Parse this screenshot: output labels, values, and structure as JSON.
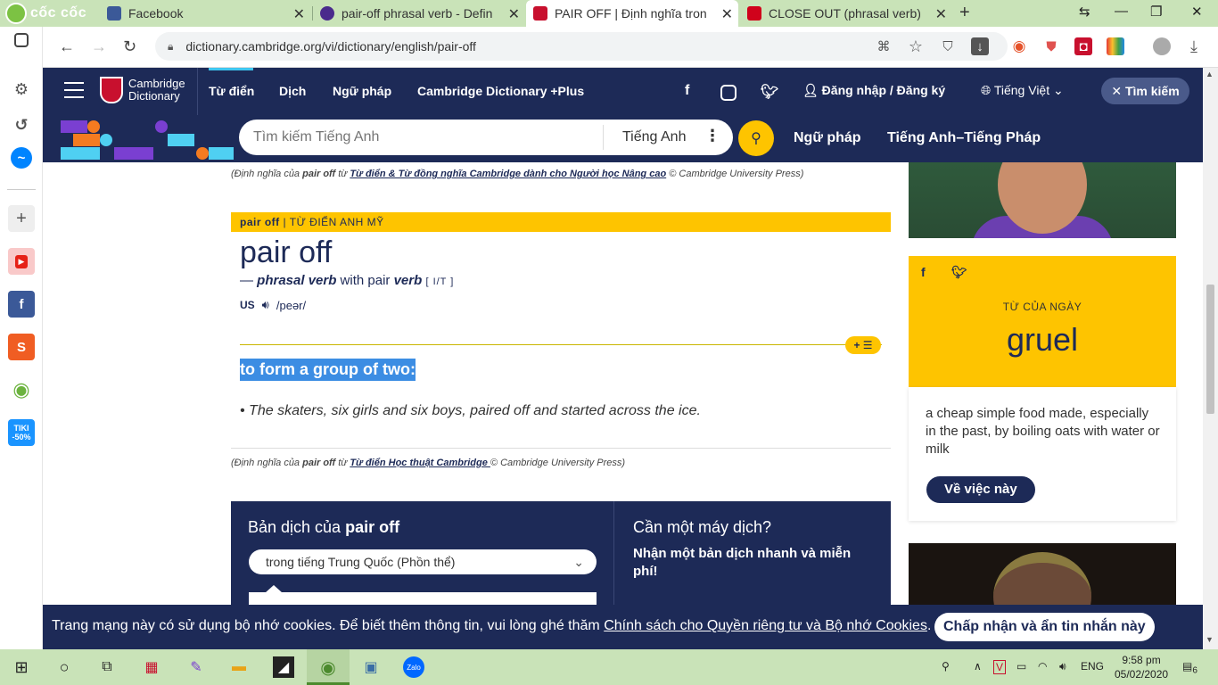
{
  "browser": {
    "brand": "cốc cốc",
    "tabs": [
      {
        "title": "Facebook",
        "favicon_color": "#3b5998"
      },
      {
        "title": "pair-off phrasal verb - Definiti",
        "favicon_color": "#4a2b8c"
      },
      {
        "title": "PAIR OFF | Định nghĩa trong T",
        "favicon_color": "#c8102e"
      },
      {
        "title": "CLOSE OUT (phrasal verb) def",
        "favicon_color": "#d0021b"
      }
    ],
    "url": "dictionary.cambridge.org/vi/dictionary/english/pair-off"
  },
  "header": {
    "logo_line1": "Cambridge",
    "logo_line2": "Dictionary",
    "nav": [
      "Từ điển",
      "Dịch",
      "Ngữ pháp",
      "Cambridge Dictionary +Plus"
    ],
    "login": "Đăng nhập / Đăng ký",
    "language": "Tiếng Việt",
    "search_toggle": "Tìm kiếm"
  },
  "search": {
    "placeholder": "Tìm kiếm Tiếng Anh",
    "language": "Tiếng Anh",
    "links": [
      "Ngữ pháp",
      "Tiếng Anh–Tiếng Pháp"
    ]
  },
  "entry": {
    "credit_top": {
      "prefix": "(Định nghĩa của ",
      "word": "pair off",
      "mid": " từ ",
      "source": "Từ điển & Từ đồng nghĩa Cambridge dành cho Người học Nâng cao",
      "suffix": " © Cambridge University Press)"
    },
    "bar_word": "pair off",
    "bar_dict": "TỪ ĐIỂN ANH MỸ",
    "headword": "pair off",
    "pos_dash": "— ",
    "pos": "phrasal verb",
    "pos_with": " with pair ",
    "pos_verb": "verb",
    "grammar": "[ I/T ]",
    "region": "US",
    "ipa": "/peər/",
    "definition": "to form a group of two:",
    "example": "The skaters, six girls and six boys, paired off and started across the ice.",
    "credit_bottom": {
      "prefix": "(Định nghĩa của ",
      "word": "pair off",
      "mid": " từ ",
      "source": "Từ điển Học thuật Cambridge ",
      "suffix": "© Cambridge University Press)"
    }
  },
  "translation": {
    "title_prefix": "Bản dịch của ",
    "title_word": "pair off",
    "select_value": "trong tiếng Trung Quốc (Phồn thể)",
    "right_title": "Cần một máy dịch?",
    "right_text": "Nhận một bản dịch nhanh và miễn phí!"
  },
  "word_of_day": {
    "label": "TỪ CỦA NGÀY",
    "word": "gruel",
    "definition": "a cheap simple food made, especially in the past, by boiling oats with water or milk",
    "button": "Về việc này"
  },
  "cookie": {
    "text": "Trang mạng này có sử dụng bộ nhớ cookies. Để biết thêm thông tin, vui lòng ghé thăm ",
    "link": "Chính sách cho Quyền riêng tư và Bộ nhớ Cookies",
    "end": ".",
    "button": "Chấp nhận và ẩn tin nhắn này"
  },
  "taskbar": {
    "lang": "ENG",
    "time": "9:58 pm",
    "date": "05/02/2020",
    "notifications": "6"
  },
  "sidebar_apps": {
    "tiki_line1": "TIKI",
    "tiki_line2": "-50%"
  }
}
